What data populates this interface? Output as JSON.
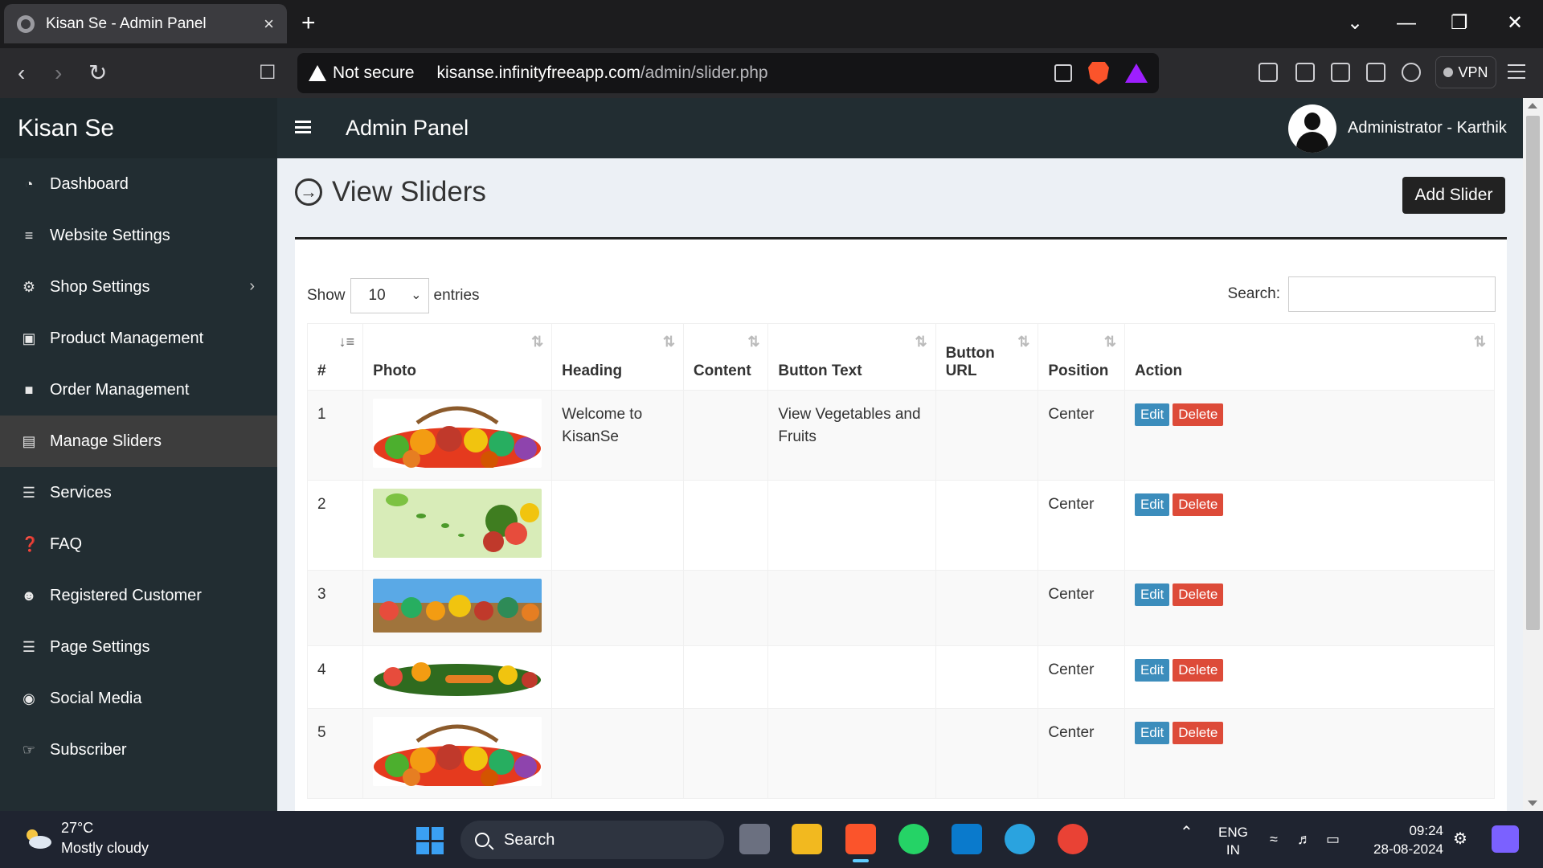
{
  "browser": {
    "tab_title": "Kisan Se - Admin Panel",
    "tab_close": "×",
    "new_tab": "+",
    "security_label": "Not secure",
    "url_host": "kisanse.infinityfreeapp.com",
    "url_path": "/admin/slider.php",
    "vpn_label": "VPN"
  },
  "header": {
    "brand": "Kisan Se",
    "panel_title": "Admin Panel",
    "user_name": "Administrator - Karthik"
  },
  "sidebar": {
    "items": [
      {
        "label": "Dashboard",
        "icon": "dashboard-icon"
      },
      {
        "label": "Website Settings",
        "icon": "sliders-icon"
      },
      {
        "label": "Shop Settings",
        "icon": "cogs-icon",
        "has_submenu": true
      },
      {
        "label": "Product Management",
        "icon": "shopping-bag-icon"
      },
      {
        "label": "Order Management",
        "icon": "order-icon"
      },
      {
        "label": "Manage Sliders",
        "icon": "picture-icon",
        "active": true
      },
      {
        "label": "Services",
        "icon": "list-icon"
      },
      {
        "label": "FAQ",
        "icon": "question-circle-icon"
      },
      {
        "label": "Registered Customer",
        "icon": "user-plus-icon"
      },
      {
        "label": "Page Settings",
        "icon": "page-icon"
      },
      {
        "label": "Social Media",
        "icon": "globe-icon"
      },
      {
        "label": "Subscriber",
        "icon": "hand-point-icon"
      }
    ]
  },
  "main": {
    "title": "View Sliders",
    "add_button": "Add Slider",
    "show_label": "Show",
    "entries_label": "entries",
    "page_length": "10",
    "search_label": "Search:",
    "columns": [
      "#",
      "Photo",
      "Heading",
      "Content",
      "Button Text",
      "Button URL",
      "Position",
      "Action"
    ],
    "rows": [
      {
        "num": "1",
        "heading": "Welcome to KisanSe",
        "content": "",
        "button_text": "View Vegetables and Fruits",
        "button_url": "",
        "position": "Center"
      },
      {
        "num": "2",
        "heading": "",
        "content": "",
        "button_text": "",
        "button_url": "",
        "position": "Center"
      },
      {
        "num": "3",
        "heading": "",
        "content": "",
        "button_text": "",
        "button_url": "",
        "position": "Center"
      },
      {
        "num": "4",
        "heading": "",
        "content": "",
        "button_text": "",
        "button_url": "",
        "position": "Center"
      },
      {
        "num": "5",
        "heading": "",
        "content": "",
        "button_text": "",
        "button_url": "",
        "position": "Center"
      }
    ],
    "edit_label": "Edit",
    "delete_label": "Delete"
  },
  "taskbar": {
    "temperature": "27°C",
    "weather": "Mostly cloudy",
    "search_label": "Search",
    "lang_top": "ENG",
    "lang_bottom": "IN",
    "time": "09:24",
    "date": "28-08-2024"
  },
  "colors": {
    "sidebar_bg": "#222d32",
    "brand_bg": "#1e282c",
    "edit_button": "#3c8dbc",
    "delete_button": "#dd4b39",
    "content_bg": "#ecf0f5"
  }
}
